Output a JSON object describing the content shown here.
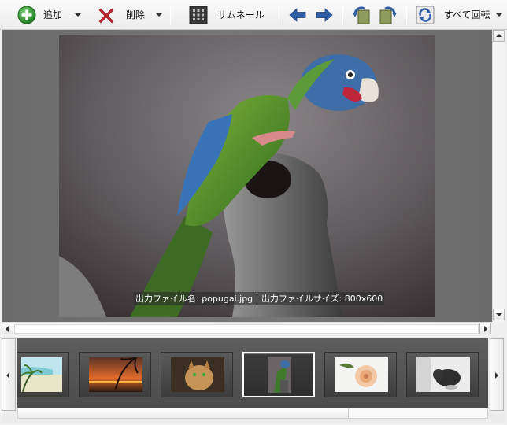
{
  "toolbar": {
    "add_label": "追加",
    "delete_label": "削除",
    "thumbnail_label": "サムネール",
    "rotate_all_label": "すべて回転"
  },
  "icons": {
    "add": "plus-circle-icon",
    "delete": "x-icon",
    "thumbnail": "grid-icon",
    "back": "arrow-left-icon",
    "forward": "arrow-right-icon",
    "rotate_left": "rotate-left-icon",
    "rotate_right": "rotate-right-icon",
    "rotate_all": "rotate-all-icon"
  },
  "preview": {
    "caption": "出力ファイル名: popugai.jpg | 出力ファイルサイズ: 800x600"
  },
  "filmstrip": {
    "thumbnails": [
      {
        "subject": "beach"
      },
      {
        "subject": "sunset-palms"
      },
      {
        "subject": "cat"
      },
      {
        "subject": "parrot",
        "selected": true
      },
      {
        "subject": "rose"
      },
      {
        "subject": "dog"
      }
    ]
  },
  "colors": {
    "add_green": "#2e9b2e",
    "delete_red": "#c0242b",
    "arrow_blue": "#2f5ea8"
  }
}
